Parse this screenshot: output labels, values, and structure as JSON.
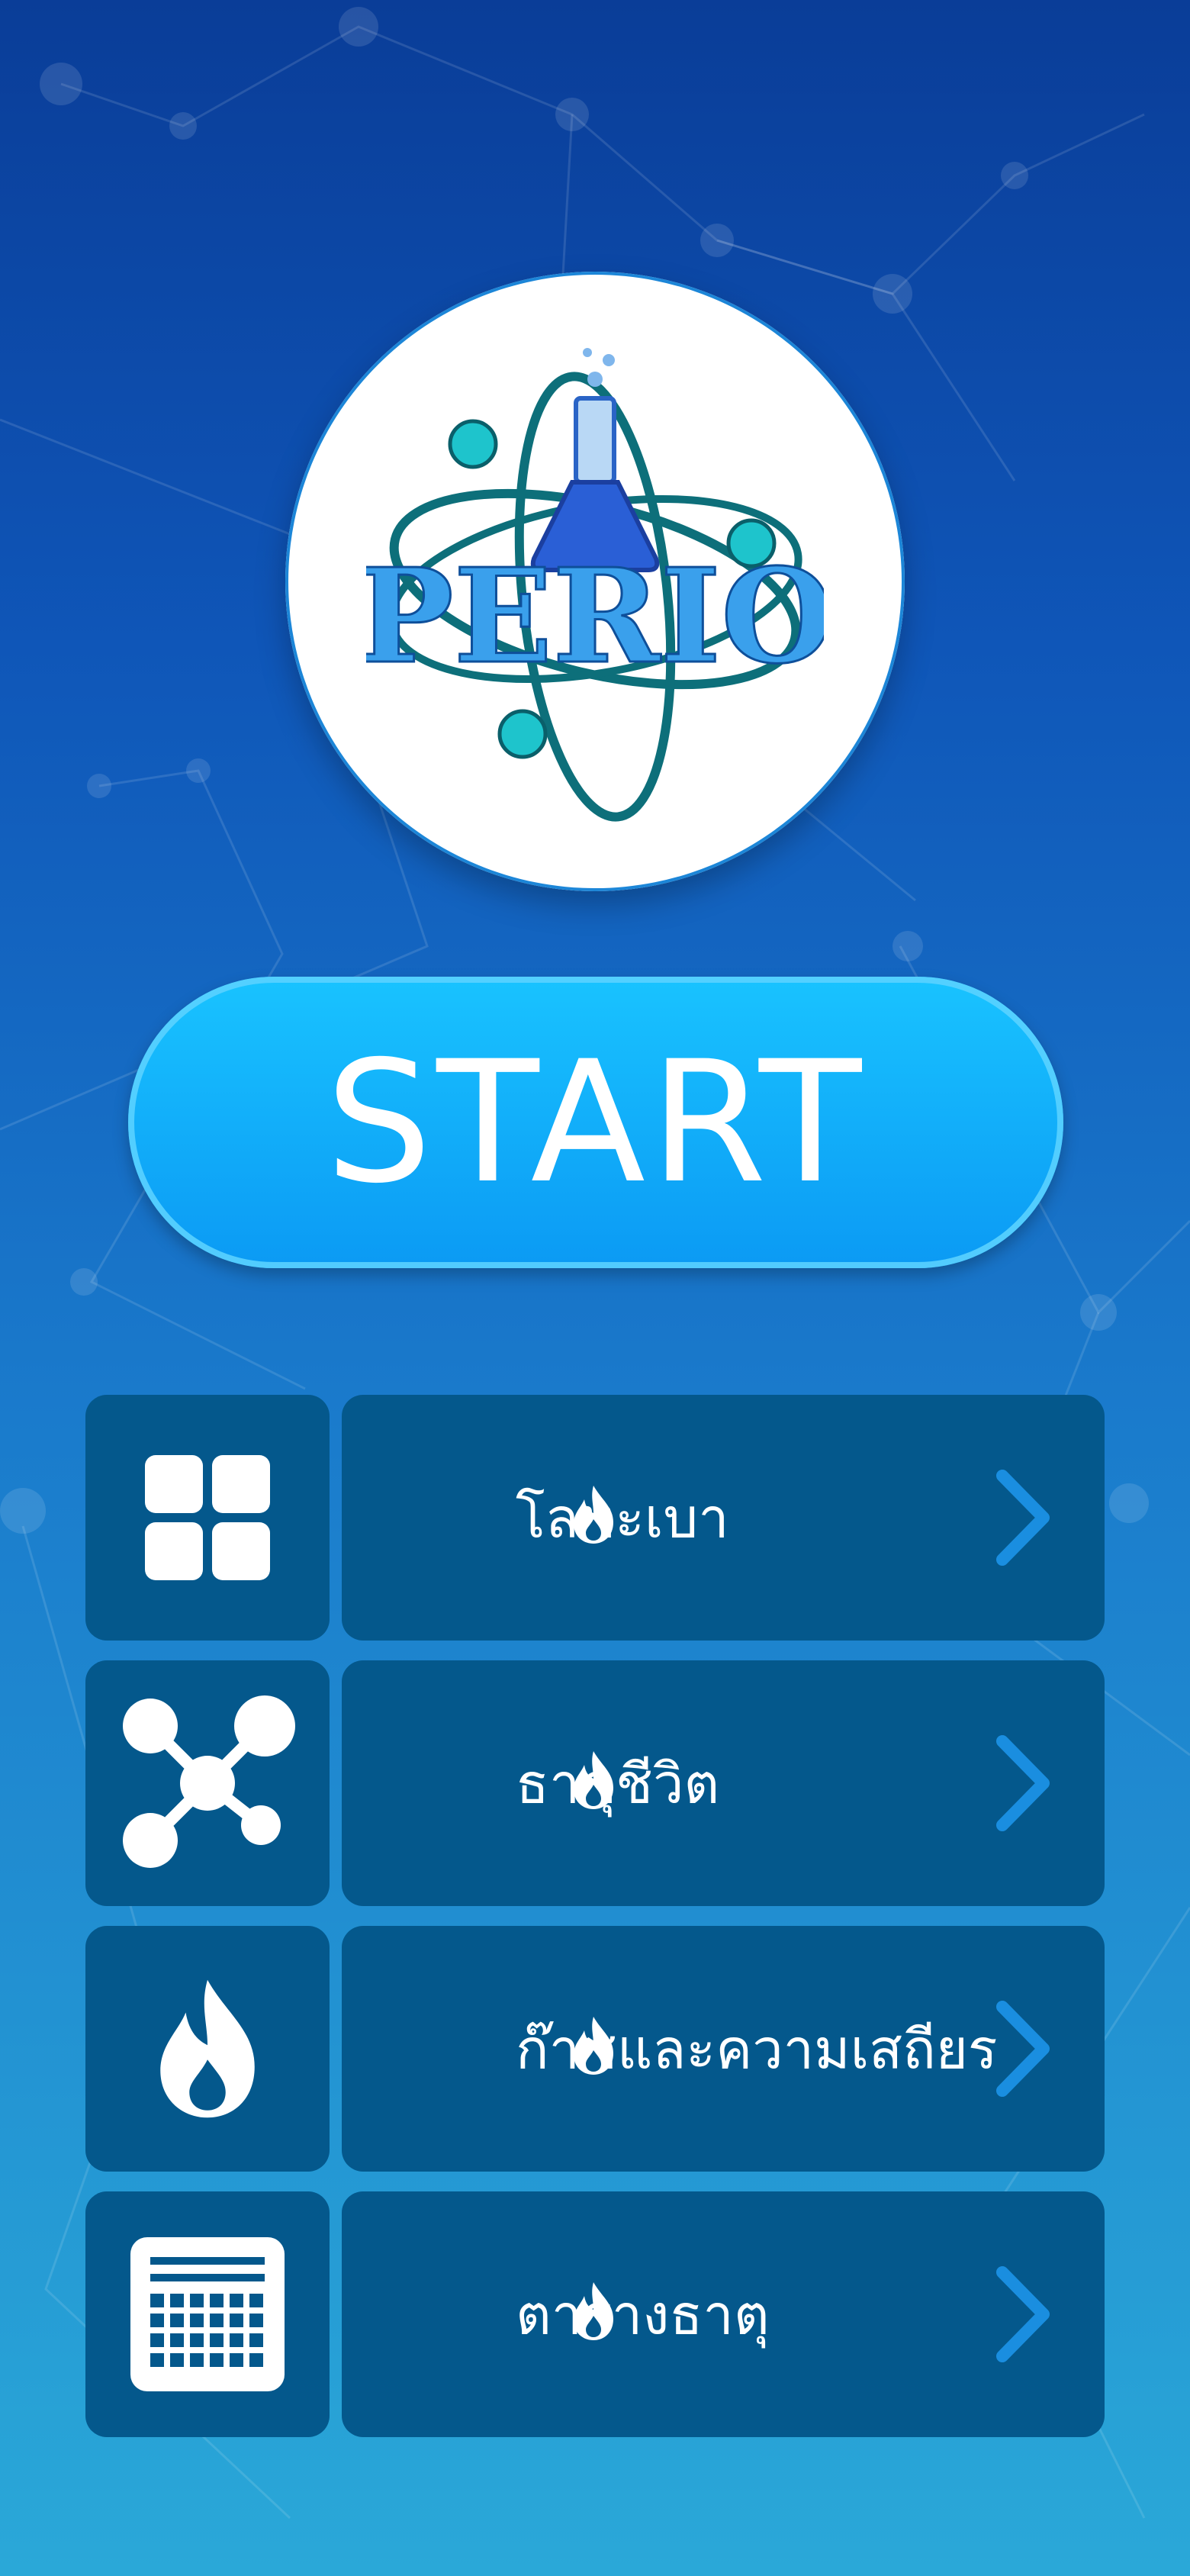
{
  "brand": {
    "logo_text": "PERIO"
  },
  "start_button": {
    "label": "START"
  },
  "menu": [
    {
      "label": "โลหะเบา",
      "icon": "grid-icon"
    },
    {
      "label": "ธาตุชีวิต",
      "icon": "molecule-icon"
    },
    {
      "label": "ก๊าซและความเสถียร",
      "icon": "flame-icon"
    },
    {
      "label": "ตารางธาตุ",
      "icon": "periodic-table-icon"
    }
  ],
  "colors": {
    "background_top": "#0a3d98",
    "background_bottom": "#2aa8d8",
    "tile": "#04588c",
    "start_button": "#0b9af4",
    "chevron": "#1a8ee0"
  }
}
